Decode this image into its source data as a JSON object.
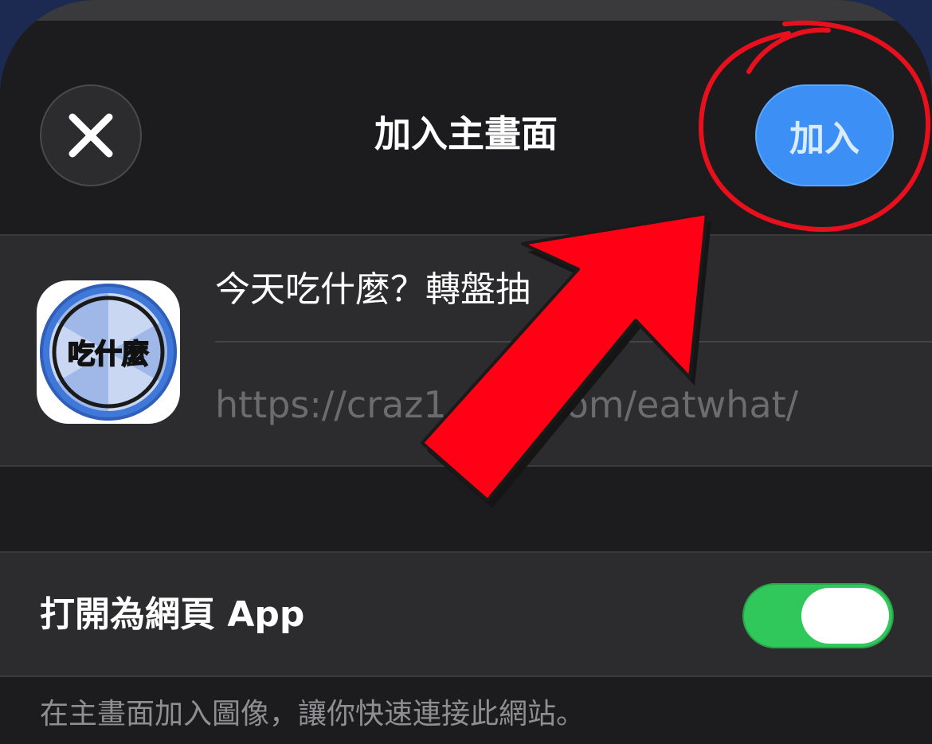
{
  "header": {
    "title": "加入主畫面",
    "add_label": "加入",
    "close_icon": "close-icon"
  },
  "app": {
    "name": "今天吃什麼？轉盤抽",
    "url": "https://craz1",
    "url_tail": "om/eatwhat/",
    "icon_label": "吃什麼"
  },
  "settings": {
    "open_as_webapp_label": "打開為網頁 App",
    "open_as_webapp_enabled": true
  },
  "footer": {
    "note": "在主畫面加入圖像，讓你快速連接此網站。"
  },
  "colors": {
    "add_button": "#3b8ff5",
    "toggle_on": "#30c85a",
    "annotation_red": "#ff0015"
  }
}
